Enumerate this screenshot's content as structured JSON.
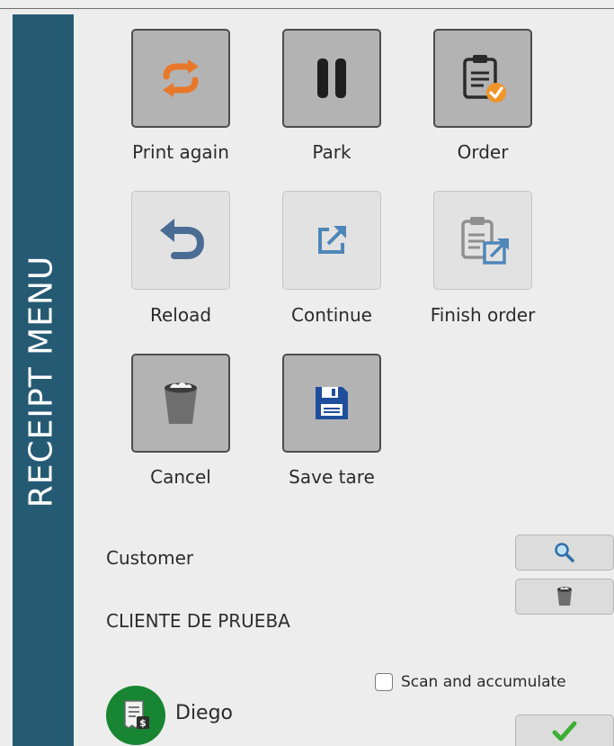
{
  "side_panel": {
    "title": "RECEIPT MENU",
    "color": "#255a73"
  },
  "actions": [
    {
      "id": "print-again",
      "label": "Print again",
      "enabled": true,
      "icon": "repeat-icon"
    },
    {
      "id": "park",
      "label": "Park",
      "enabled": true,
      "icon": "pause-icon"
    },
    {
      "id": "order",
      "label": "Order",
      "enabled": true,
      "icon": "clipboard-check-icon"
    },
    {
      "id": "reload",
      "label": "Reload",
      "enabled": false,
      "icon": "undo-arrow-icon"
    },
    {
      "id": "continue",
      "label": "Continue",
      "enabled": false,
      "icon": "external-link-icon"
    },
    {
      "id": "finish-order",
      "label": "Finish order",
      "enabled": false,
      "icon": "clipboard-export-icon"
    },
    {
      "id": "cancel",
      "label": "Cancel",
      "enabled": true,
      "icon": "trash-bin-icon"
    },
    {
      "id": "save-tare",
      "label": "Save tare",
      "enabled": true,
      "icon": "floppy-disk-icon"
    }
  ],
  "customer": {
    "label": "Customer",
    "value": "CLIENTE DE PRUEBA",
    "search_icon": "search-icon",
    "clear_icon": "trash-bin-icon"
  },
  "scan_and_accumulate": {
    "label": "Scan and accumulate",
    "checked": false
  },
  "user": {
    "name": "Diego",
    "avatar_icon": "receipt-dollar-icon",
    "avatar_color": "#178532"
  },
  "confirm": {
    "icon": "checkmark-icon"
  },
  "colors": {
    "accent_orange": "#e8772a",
    "icon_dark": "#2b2b2b",
    "icon_blue": "#1f4e9c",
    "confirm_green": "#3cb034"
  }
}
